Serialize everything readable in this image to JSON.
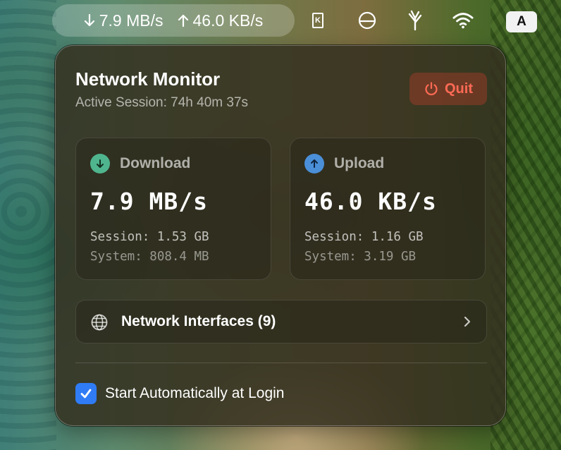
{
  "menubar": {
    "download_rate": "7.9 MB/s",
    "upload_rate": "46.0 KB/s",
    "input_source": "A",
    "keyboard_icon_letter": "K",
    "icons": [
      "download-arrow-icon",
      "upload-arrow-icon",
      "keyboard-icon",
      "half-circle-icon",
      "app-sprout-icon",
      "wifi-icon"
    ]
  },
  "panel": {
    "title": "Network Monitor",
    "subtitle": "Active Session: 74h 40m 37s",
    "quit_label": "Quit",
    "download": {
      "heading": "Download",
      "rate": "7.9 MB/s",
      "session": "Session: 1.53 GB",
      "system": "System: 808.4 MB",
      "color": "#4fb58e"
    },
    "upload": {
      "heading": "Upload",
      "rate": "46.0 KB/s",
      "session": "Session: 1.16 GB",
      "system": "System: 3.19 GB",
      "color": "#4a8fd8"
    },
    "interfaces_label": "Network Interfaces (9)",
    "login_label": "Start Automatically at Login",
    "login_checked": true
  },
  "colors": {
    "quit": "#ff6a55",
    "checkbox": "#2f7cf6"
  }
}
